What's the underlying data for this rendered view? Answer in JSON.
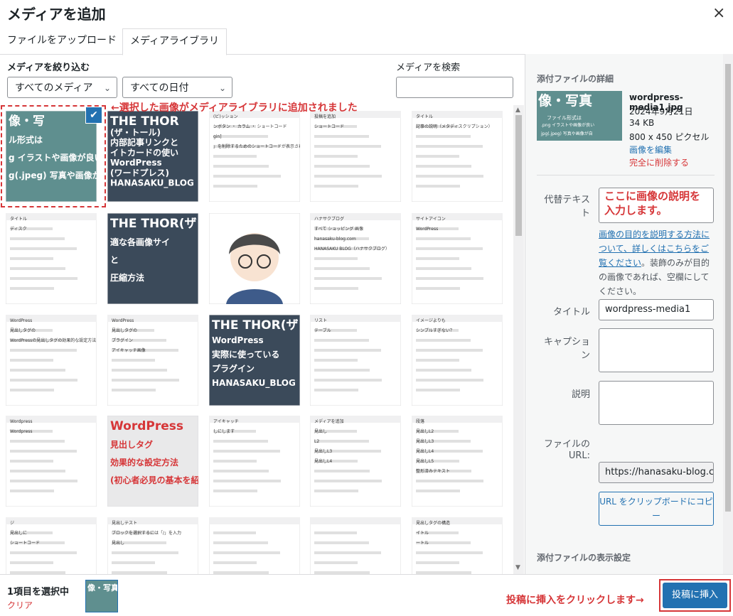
{
  "modal": {
    "title": "メディアを追加",
    "close_glyph": "×"
  },
  "tabs": [
    {
      "label": "ファイルをアップロード"
    },
    {
      "label": "メディアライブラリ"
    }
  ],
  "filter": {
    "label": "メディアを絞り込む",
    "type_value": "すべてのメディア",
    "date_value": "すべての日付"
  },
  "search": {
    "label": "メディアを検索",
    "placeholder": ""
  },
  "annotations": {
    "selected": "←選択した画像がメディアライブラリに追加されました",
    "alt": [
      "ここに画像の説明を",
      "入力します。"
    ],
    "insert": "投稿に挿入をクリックします→"
  },
  "thumbnails": [
    {
      "kind": "teal",
      "lines": [
        "像・写",
        "ル形式は",
        "g イラストや画像が良い",
        "g(.jpeg) 写真や画像が自"
      ]
    },
    {
      "kind": "dark",
      "lines": [
        "THE THOR",
        "(ザ・トール)",
        "内部記事リンクと",
        "イトカードの使い",
        "WordPress",
        "(ワードプレス)",
        "HANASAKU_BLOG"
      ]
    },
    {
      "kind": "shot",
      "lines": [
        "(ビ)ッション",
        "ンボタン ・ カラム ・ ショートコード",
        "gin]",
        "」を削除するためのショートコードが表示されました"
      ]
    },
    {
      "kind": "shot",
      "lines": [
        "投稿を追加",
        "ショートコード"
      ]
    },
    {
      "kind": "shot",
      "lines": [
        "タイトル",
        "記事の説明（メタディスクリプション）"
      ]
    },
    {
      "kind": "shot",
      "lines": [
        "タイトル",
        "ディスク"
      ]
    },
    {
      "kind": "dark",
      "lines": [
        "THE THOR(ザ・トール)で",
        "適な各画像サイ",
        "と",
        "圧縮方法"
      ]
    },
    {
      "kind": "avatar",
      "lines": []
    },
    {
      "kind": "shot",
      "lines": [
        "ハナサクブログ",
        "すべて ショッピング 画像",
        "hanasaku-blog.com",
        "HANASAKU BLOG（ハナサクブログ）"
      ]
    },
    {
      "kind": "shot",
      "lines": [
        "サイトアイコン",
        "WordPress"
      ]
    },
    {
      "kind": "shot",
      "lines": [
        "WordPress",
        "見出しタグの",
        "WordPressの見出しタグの効果的な設定方法"
      ]
    },
    {
      "kind": "shot",
      "lines": [
        "WordPress",
        "見出しタグの",
        "プラグイン",
        "アイキャッチ画像"
      ]
    },
    {
      "kind": "dark",
      "lines": [
        "THE THOR(ザ・トール)で",
        "WordPress",
        "実際に使っている",
        "プラグイン",
        "HANASAKU_BLOG"
      ]
    },
    {
      "kind": "shot",
      "lines": [
        "リスト",
        "テーブル"
      ]
    },
    {
      "kind": "shot",
      "lines": [
        "イメージよりも",
        "シンプルすぎない？"
      ]
    },
    {
      "kind": "shot",
      "lines": [
        "Wordpress",
        "Wordpress"
      ]
    },
    {
      "kind": "pink",
      "lines": [
        "WordPress",
        "見出しタグ",
        "効果的な設定方法",
        "(初心者必見の基本を紹介)"
      ]
    },
    {
      "kind": "shot",
      "lines": [
        "アイキャッチ",
        "しにします"
      ]
    },
    {
      "kind": "shot",
      "lines": [
        "メディアを追加",
        "見出し",
        "L2",
        "見出しL3",
        "見出しL4"
      ]
    },
    {
      "kind": "shot",
      "lines": [
        "段落",
        "見出しL2",
        "見出しL3",
        "見出しL4",
        "見出しL5",
        "整形済みテキスト"
      ]
    },
    {
      "kind": "shot",
      "lines": [
        "ジ",
        "見出しに",
        "ショートコード"
      ]
    },
    {
      "kind": "shot",
      "lines": [
        "見出しテスト",
        "ブロックを選択するには「/」を入力",
        "見出し"
      ]
    },
    {
      "kind": "shot",
      "lines": []
    },
    {
      "kind": "shot",
      "lines": []
    },
    {
      "kind": "shot",
      "lines": [
        "見出しタグの構造",
        "イトル",
        "ートル"
      ]
    }
  ],
  "details": {
    "heading": "添付ファイルの詳細",
    "filename": "wordpress-media1.jpg",
    "date": "2024年9月21日",
    "size": "34 KB",
    "dimensions": "800 x 450 ピクセル",
    "edit_link": "画像を編集",
    "delete_link": "完全に削除する",
    "preview_lines": [
      "像・写真",
      "ファイル形式は",
      ".png イラストや画像が良い",
      "jpg(.jpeg) 写真や画像が自"
    ]
  },
  "fields": {
    "alt_label": "代替テキスト",
    "alt_value": "",
    "help_link": "画像の目的を説明する方法について、詳しくはこちらをご覧ください",
    "help_text": "。装飾のみが目的の画像であれば、空欄にしてください。",
    "title_label": "タイトル",
    "title_value": "wordpress-media1",
    "caption_label": "キャプション",
    "caption_value": "",
    "description_label": "説明",
    "description_value": "",
    "url_label": "ファイルの URL:",
    "url_value": "https://hanasaku-blog.co",
    "copy_button": "URL をクリップボードにコピー"
  },
  "display_settings": {
    "heading": "添付ファイルの表示設定"
  },
  "footer": {
    "selected_count": "1項目を選択中",
    "clear": "クリア",
    "insert_button": "投稿に挿入"
  }
}
